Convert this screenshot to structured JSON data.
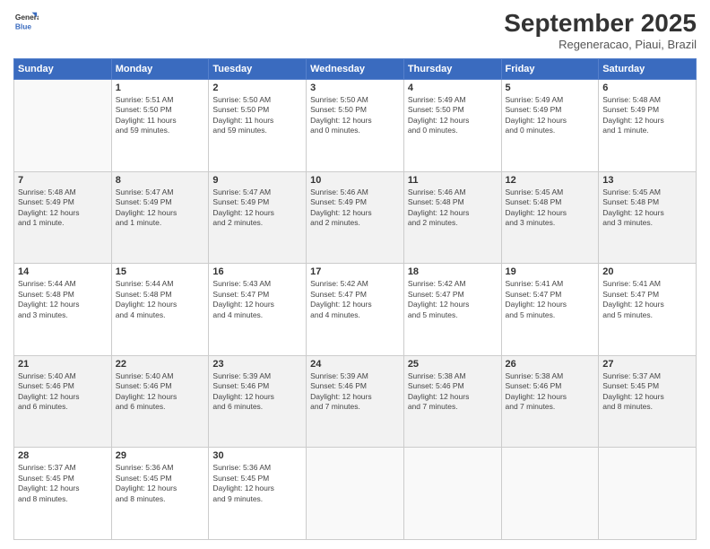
{
  "header": {
    "logo_general": "General",
    "logo_blue": "Blue",
    "month": "September 2025",
    "location": "Regeneracao, Piaui, Brazil"
  },
  "days_of_week": [
    "Sunday",
    "Monday",
    "Tuesday",
    "Wednesday",
    "Thursday",
    "Friday",
    "Saturday"
  ],
  "weeks": [
    [
      {
        "day": "",
        "info": ""
      },
      {
        "day": "1",
        "info": "Sunrise: 5:51 AM\nSunset: 5:50 PM\nDaylight: 11 hours\nand 59 minutes."
      },
      {
        "day": "2",
        "info": "Sunrise: 5:50 AM\nSunset: 5:50 PM\nDaylight: 11 hours\nand 59 minutes."
      },
      {
        "day": "3",
        "info": "Sunrise: 5:50 AM\nSunset: 5:50 PM\nDaylight: 12 hours\nand 0 minutes."
      },
      {
        "day": "4",
        "info": "Sunrise: 5:49 AM\nSunset: 5:50 PM\nDaylight: 12 hours\nand 0 minutes."
      },
      {
        "day": "5",
        "info": "Sunrise: 5:49 AM\nSunset: 5:49 PM\nDaylight: 12 hours\nand 0 minutes."
      },
      {
        "day": "6",
        "info": "Sunrise: 5:48 AM\nSunset: 5:49 PM\nDaylight: 12 hours\nand 1 minute."
      }
    ],
    [
      {
        "day": "7",
        "info": "Sunrise: 5:48 AM\nSunset: 5:49 PM\nDaylight: 12 hours\nand 1 minute."
      },
      {
        "day": "8",
        "info": "Sunrise: 5:47 AM\nSunset: 5:49 PM\nDaylight: 12 hours\nand 1 minute."
      },
      {
        "day": "9",
        "info": "Sunrise: 5:47 AM\nSunset: 5:49 PM\nDaylight: 12 hours\nand 2 minutes."
      },
      {
        "day": "10",
        "info": "Sunrise: 5:46 AM\nSunset: 5:49 PM\nDaylight: 12 hours\nand 2 minutes."
      },
      {
        "day": "11",
        "info": "Sunrise: 5:46 AM\nSunset: 5:48 PM\nDaylight: 12 hours\nand 2 minutes."
      },
      {
        "day": "12",
        "info": "Sunrise: 5:45 AM\nSunset: 5:48 PM\nDaylight: 12 hours\nand 3 minutes."
      },
      {
        "day": "13",
        "info": "Sunrise: 5:45 AM\nSunset: 5:48 PM\nDaylight: 12 hours\nand 3 minutes."
      }
    ],
    [
      {
        "day": "14",
        "info": "Sunrise: 5:44 AM\nSunset: 5:48 PM\nDaylight: 12 hours\nand 3 minutes."
      },
      {
        "day": "15",
        "info": "Sunrise: 5:44 AM\nSunset: 5:48 PM\nDaylight: 12 hours\nand 4 minutes."
      },
      {
        "day": "16",
        "info": "Sunrise: 5:43 AM\nSunset: 5:47 PM\nDaylight: 12 hours\nand 4 minutes."
      },
      {
        "day": "17",
        "info": "Sunrise: 5:42 AM\nSunset: 5:47 PM\nDaylight: 12 hours\nand 4 minutes."
      },
      {
        "day": "18",
        "info": "Sunrise: 5:42 AM\nSunset: 5:47 PM\nDaylight: 12 hours\nand 5 minutes."
      },
      {
        "day": "19",
        "info": "Sunrise: 5:41 AM\nSunset: 5:47 PM\nDaylight: 12 hours\nand 5 minutes."
      },
      {
        "day": "20",
        "info": "Sunrise: 5:41 AM\nSunset: 5:47 PM\nDaylight: 12 hours\nand 5 minutes."
      }
    ],
    [
      {
        "day": "21",
        "info": "Sunrise: 5:40 AM\nSunset: 5:46 PM\nDaylight: 12 hours\nand 6 minutes."
      },
      {
        "day": "22",
        "info": "Sunrise: 5:40 AM\nSunset: 5:46 PM\nDaylight: 12 hours\nand 6 minutes."
      },
      {
        "day": "23",
        "info": "Sunrise: 5:39 AM\nSunset: 5:46 PM\nDaylight: 12 hours\nand 6 minutes."
      },
      {
        "day": "24",
        "info": "Sunrise: 5:39 AM\nSunset: 5:46 PM\nDaylight: 12 hours\nand 7 minutes."
      },
      {
        "day": "25",
        "info": "Sunrise: 5:38 AM\nSunset: 5:46 PM\nDaylight: 12 hours\nand 7 minutes."
      },
      {
        "day": "26",
        "info": "Sunrise: 5:38 AM\nSunset: 5:46 PM\nDaylight: 12 hours\nand 7 minutes."
      },
      {
        "day": "27",
        "info": "Sunrise: 5:37 AM\nSunset: 5:45 PM\nDaylight: 12 hours\nand 8 minutes."
      }
    ],
    [
      {
        "day": "28",
        "info": "Sunrise: 5:37 AM\nSunset: 5:45 PM\nDaylight: 12 hours\nand 8 minutes."
      },
      {
        "day": "29",
        "info": "Sunrise: 5:36 AM\nSunset: 5:45 PM\nDaylight: 12 hours\nand 8 minutes."
      },
      {
        "day": "30",
        "info": "Sunrise: 5:36 AM\nSunset: 5:45 PM\nDaylight: 12 hours\nand 9 minutes."
      },
      {
        "day": "",
        "info": ""
      },
      {
        "day": "",
        "info": ""
      },
      {
        "day": "",
        "info": ""
      },
      {
        "day": "",
        "info": ""
      }
    ]
  ]
}
